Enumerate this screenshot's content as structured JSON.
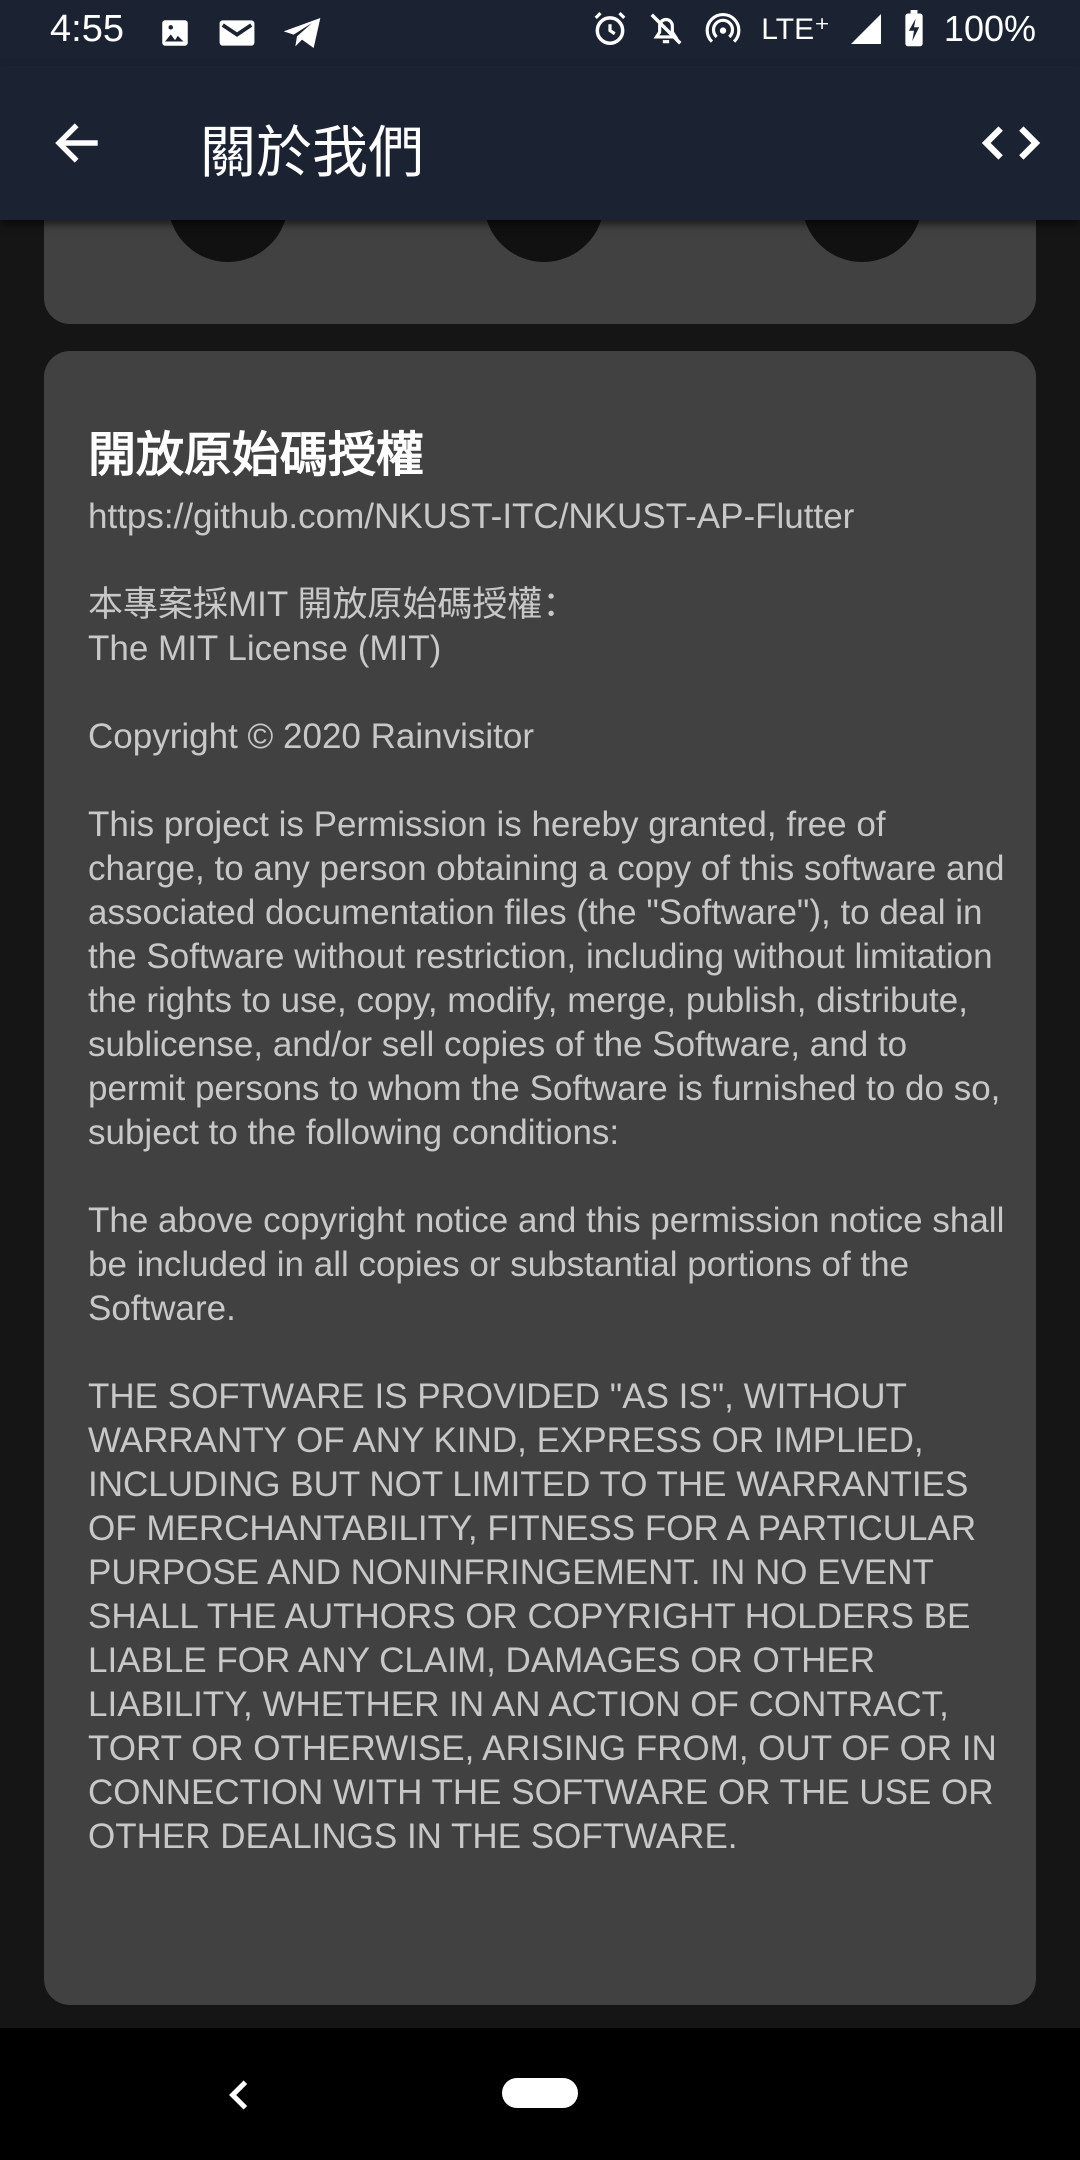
{
  "status_bar": {
    "time": "4:55",
    "network": "LTE⁺",
    "battery": "100%"
  },
  "app_bar": {
    "title": "關於我們"
  },
  "license_card": {
    "title": "開放原始碼授權",
    "body": "https://github.com/NKUST-ITC/NKUST-AP-Flutter\n\n本專案採MIT 開放原始碼授權：\nThe MIT License (MIT)\n\nCopyright © 2020 Rainvisitor\n\nThis project is Permission is hereby granted, free of charge, to any person obtaining a copy of this software and associated documentation files (the \"Software\"), to deal in the Software without restriction, including without limitation the rights to use, copy, modify, merge, publish, distribute, sublicense, and/or sell copies of the Software, and to permit persons to whom the Software is furnished to do so, subject to the following conditions:\n\nThe above copyright notice and this permission notice shall be included in all copies or substantial portions of the Software.\n\nTHE SOFTWARE IS PROVIDED \"AS IS\", WITHOUT WARRANTY OF ANY KIND, EXPRESS OR IMPLIED, INCLUDING BUT NOT LIMITED TO THE WARRANTIES OF MERCHANTABILITY, FITNESS FOR A PARTICULAR PURPOSE AND NONINFRINGEMENT. IN NO EVENT SHALL THE AUTHORS OR COPYRIGHT HOLDERS BE LIABLE FOR ANY CLAIM, DAMAGES OR OTHER LIABILITY, WHETHER IN AN ACTION OF CONTRACT, TORT OR OTHERWISE, ARISING FROM, OUT OF OR IN CONNECTION WITH THE SOFTWARE OR THE USE OR OTHER DEALINGS IN THE SOFTWARE."
  },
  "icons": {
    "back": "arrow-back-icon",
    "code": "code-icon",
    "status": [
      "image-icon",
      "gmail-icon",
      "telegram-icon",
      "alarm-icon",
      "silent-icon",
      "hotspot-icon",
      "signal-icon",
      "battery-charging-icon"
    ],
    "nav": [
      "nav-back-icon",
      "home-pill"
    ]
  },
  "colors": {
    "app_bar": "#1b2333",
    "background": "#151515",
    "card": "#414141",
    "body_text": "#c8c8c8",
    "title_text": "#ffffff"
  }
}
